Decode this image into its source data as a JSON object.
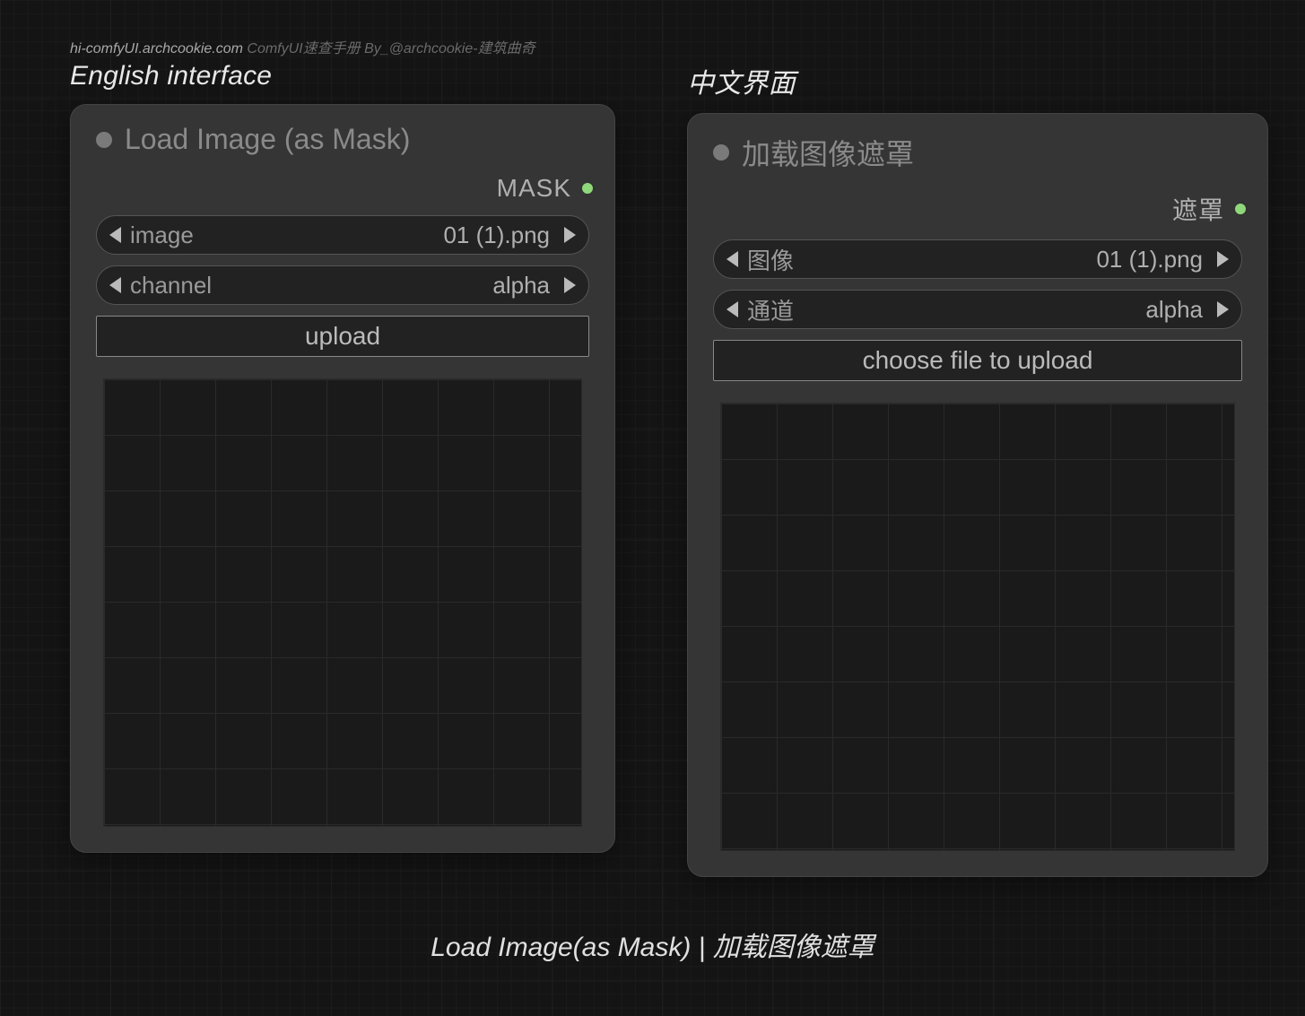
{
  "watermark": {
    "site": "hi-comfyUI.archcookie.com",
    "rest": " ComfyUI速查手册 By_@archcookie-建筑曲奇"
  },
  "labels": {
    "en_section": "English interface",
    "cn_section": "中文界面"
  },
  "node_en": {
    "title": "Load Image (as Mask)",
    "output_label": "MASK",
    "widgets": {
      "image": {
        "label": "image",
        "value": "01 (1).png"
      },
      "channel": {
        "label": "channel",
        "value": "alpha"
      },
      "upload_label": "upload"
    }
  },
  "node_cn": {
    "title": "加载图像遮罩",
    "output_label": "遮罩",
    "widgets": {
      "image": {
        "label": "图像",
        "value": "01 (1).png"
      },
      "channel": {
        "label": "通道",
        "value": "alpha"
      },
      "upload_label": "choose file to upload"
    }
  },
  "caption": "Load Image(as Mask) | 加载图像遮罩"
}
